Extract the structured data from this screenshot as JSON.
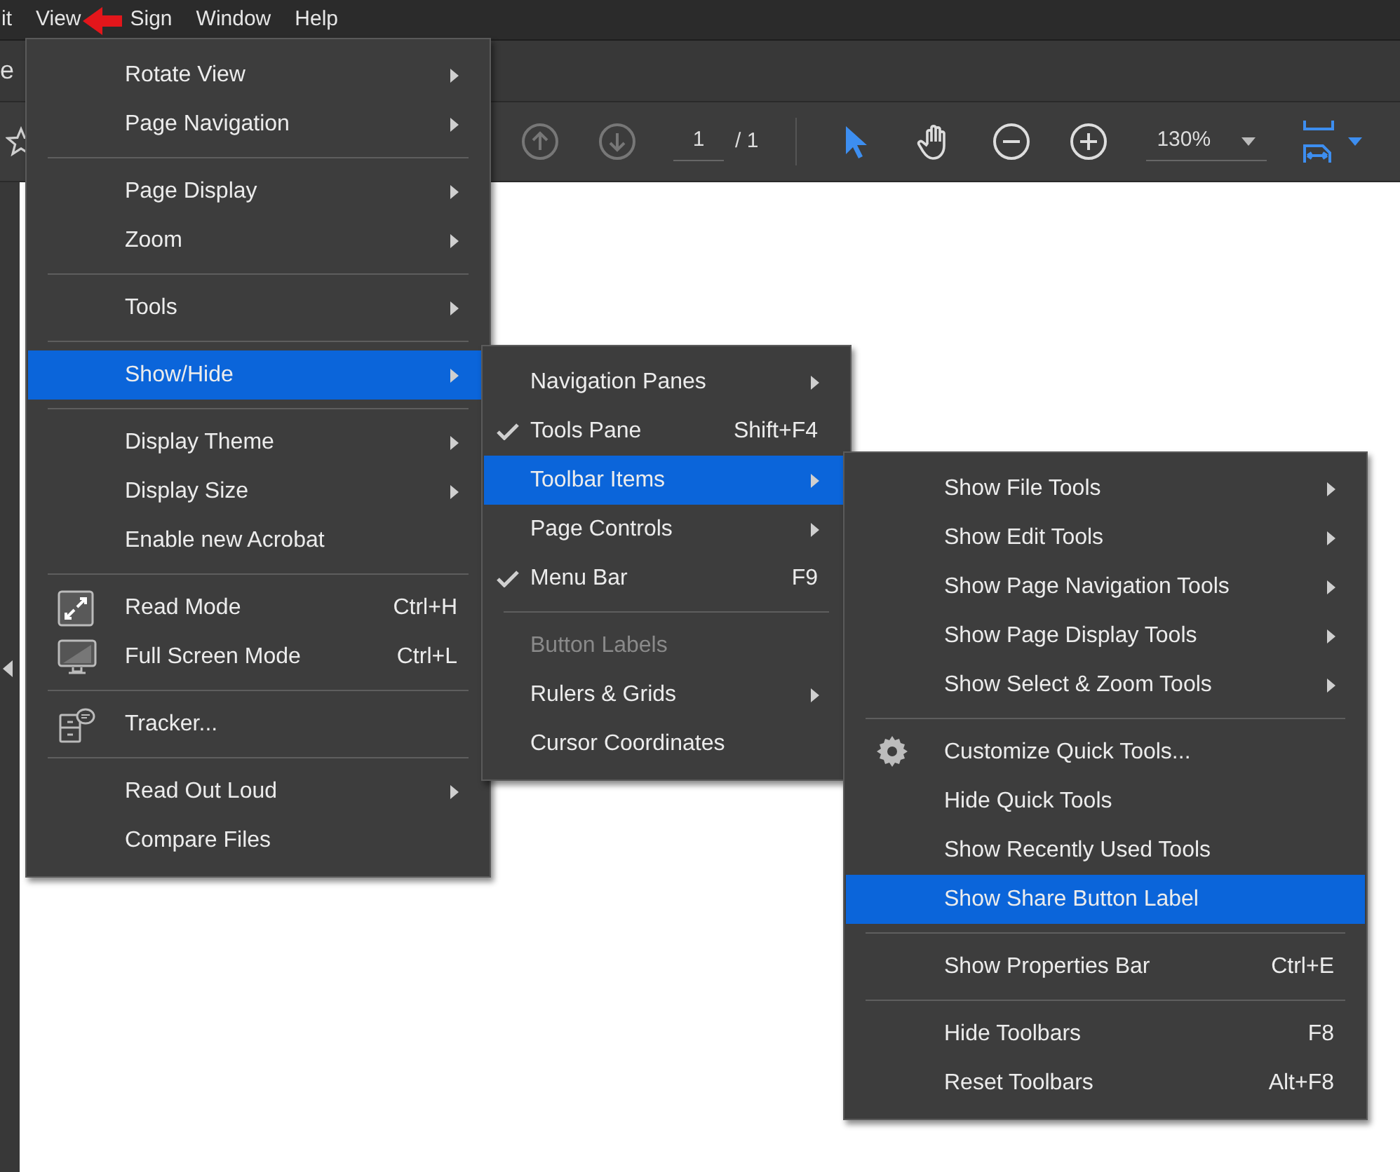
{
  "menu_bar": [
    {
      "label": "it"
    },
    {
      "label": "View"
    },
    {
      "label": "Sign"
    },
    {
      "label": "Window"
    },
    {
      "label": "Help"
    }
  ],
  "tab_bar": {
    "label": "e"
  },
  "toolbar": {
    "page_field": "1",
    "page_total": "/ 1",
    "zoom": "130%"
  },
  "view_menu": [
    {
      "kind": "item",
      "label": "Rotate View",
      "has_submenu": true,
      "selected": false
    },
    {
      "kind": "item",
      "label": "Page Navigation",
      "has_submenu": true,
      "selected": false
    },
    {
      "kind": "separator"
    },
    {
      "kind": "item",
      "label": "Page Display",
      "has_submenu": true,
      "selected": false
    },
    {
      "kind": "item",
      "label": "Zoom",
      "has_submenu": true,
      "selected": false
    },
    {
      "kind": "separator"
    },
    {
      "kind": "item",
      "label": "Tools",
      "has_submenu": true,
      "selected": false
    },
    {
      "kind": "separator"
    },
    {
      "kind": "item",
      "label": "Show/Hide",
      "has_submenu": true,
      "selected": true
    },
    {
      "kind": "separator"
    },
    {
      "kind": "item",
      "label": "Display Theme",
      "has_submenu": true,
      "selected": false
    },
    {
      "kind": "item",
      "label": "Display Size",
      "has_submenu": true,
      "selected": false
    },
    {
      "kind": "item",
      "label": "Enable new Acrobat",
      "has_submenu": false,
      "selected": false
    },
    {
      "kind": "separator"
    },
    {
      "kind": "item",
      "label": "Read Mode",
      "shortcut": "Ctrl+H",
      "has_submenu": false,
      "selected": false
    },
    {
      "kind": "item",
      "label": "Full Screen Mode",
      "shortcut": "Ctrl+L",
      "has_submenu": false,
      "selected": false
    },
    {
      "kind": "separator"
    },
    {
      "kind": "item",
      "label": "Tracker...",
      "has_submenu": false,
      "selected": false
    },
    {
      "kind": "separator"
    },
    {
      "kind": "item",
      "label": "Read Out Loud",
      "has_submenu": true,
      "selected": false
    },
    {
      "kind": "item",
      "label": "Compare Files",
      "has_submenu": false,
      "selected": false
    }
  ],
  "show_hide_menu": [
    {
      "kind": "item",
      "label": "Navigation Panes",
      "has_submenu": true,
      "selected": false,
      "checked": false,
      "disabled": false
    },
    {
      "kind": "item",
      "label": "Tools Pane",
      "shortcut": "Shift+F4",
      "has_submenu": false,
      "selected": false,
      "checked": true,
      "disabled": false
    },
    {
      "kind": "item",
      "label": "Toolbar Items",
      "has_submenu": true,
      "selected": true,
      "checked": false,
      "disabled": false
    },
    {
      "kind": "item",
      "label": "Page Controls",
      "has_submenu": true,
      "selected": false,
      "checked": false,
      "disabled": false
    },
    {
      "kind": "item",
      "label": "Menu Bar",
      "shortcut": "F9",
      "has_submenu": false,
      "selected": false,
      "checked": true,
      "disabled": false
    },
    {
      "kind": "separator"
    },
    {
      "kind": "item",
      "label": "Button Labels",
      "has_submenu": false,
      "selected": false,
      "checked": false,
      "disabled": true
    },
    {
      "kind": "item",
      "label": "Rulers & Grids",
      "has_submenu": true,
      "selected": false,
      "checked": false,
      "disabled": false
    },
    {
      "kind": "item",
      "label": "Cursor Coordinates",
      "has_submenu": false,
      "selected": false,
      "checked": false,
      "disabled": false
    }
  ],
  "toolbar_items_menu": [
    {
      "kind": "item",
      "label": "Show File Tools",
      "has_submenu": true,
      "selected": false
    },
    {
      "kind": "item",
      "label": "Show Edit Tools",
      "has_submenu": true,
      "selected": false
    },
    {
      "kind": "item",
      "label": "Show Page Navigation Tools",
      "has_submenu": true,
      "selected": false
    },
    {
      "kind": "item",
      "label": "Show Page Display Tools",
      "has_submenu": true,
      "selected": false
    },
    {
      "kind": "item",
      "label": "Show Select & Zoom Tools",
      "has_submenu": true,
      "selected": false
    },
    {
      "kind": "separator"
    },
    {
      "kind": "item",
      "label": "Customize Quick Tools...",
      "has_submenu": false,
      "selected": false
    },
    {
      "kind": "item",
      "label": "Hide Quick Tools",
      "has_submenu": false,
      "selected": false
    },
    {
      "kind": "item",
      "label": "Show Recently Used Tools",
      "has_submenu": false,
      "selected": false
    },
    {
      "kind": "item",
      "label": "Show Share Button Label",
      "has_submenu": false,
      "selected": true
    },
    {
      "kind": "separator"
    },
    {
      "kind": "item",
      "label": "Show Properties Bar",
      "shortcut": "Ctrl+E",
      "has_submenu": false,
      "selected": false
    },
    {
      "kind": "separator"
    },
    {
      "kind": "item",
      "label": "Hide Toolbars",
      "shortcut": "F8",
      "has_submenu": false,
      "selected": false
    },
    {
      "kind": "item",
      "label": "Reset Toolbars",
      "shortcut": "Alt+F8",
      "has_submenu": false,
      "selected": false
    }
  ]
}
